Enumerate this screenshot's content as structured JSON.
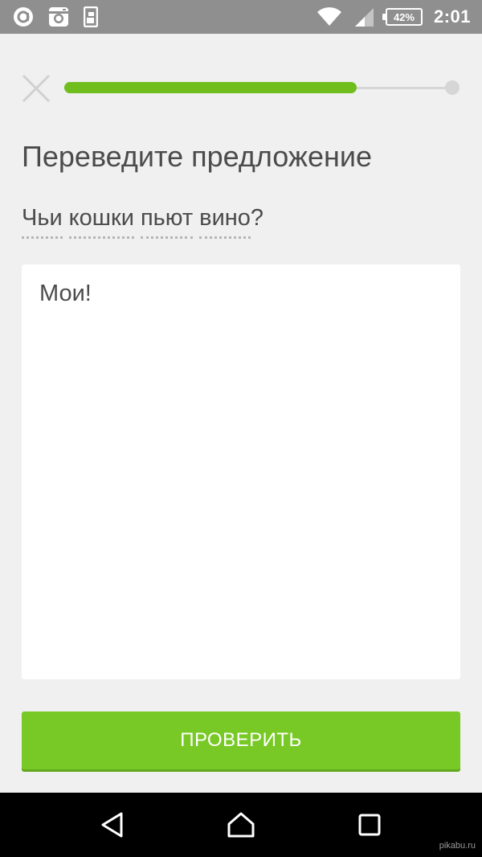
{
  "status_bar": {
    "battery": "42%",
    "time": "2:01",
    "left_icons": [
      "at-sign-icon",
      "instagram-icon",
      "sim-card-icon"
    ],
    "right_icons": [
      "wifi-icon",
      "signal-icon",
      "battery-icon"
    ]
  },
  "lesson": {
    "progress": 0.78,
    "title": "Переведите предложение",
    "sentence_words": [
      "Чьи",
      "кошки",
      "пьют",
      "вино"
    ],
    "sentence_punct": "?",
    "answer_value": "Мои!",
    "check_label": "ПРОВЕРИТЬ"
  },
  "nav": {
    "buttons": [
      "back-icon",
      "home-icon",
      "recents-icon"
    ]
  },
  "watermark": "pikabu.ru",
  "colors": {
    "accent_green": "#78c926",
    "progress_green": "#6fbe1d",
    "status_bar": "#8f8f8f",
    "background": "#f0f0f0",
    "text": "#4b4b4b"
  }
}
